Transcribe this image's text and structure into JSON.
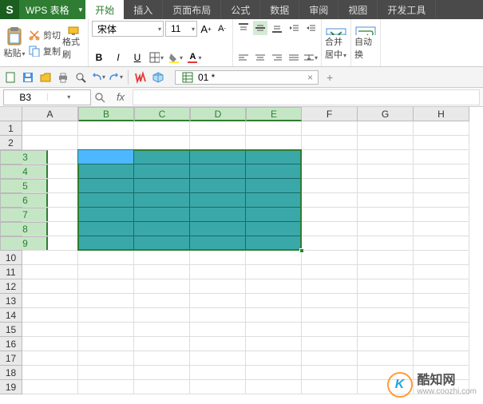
{
  "app": {
    "name": "WPS 表格"
  },
  "tabs": [
    "开始",
    "插入",
    "页面布局",
    "公式",
    "数据",
    "审阅",
    "视图",
    "开发工具"
  ],
  "active_tab": 0,
  "ribbon": {
    "paste": "粘贴",
    "cut": "剪切",
    "copy": "复制",
    "format_painter": "格式刷",
    "font_name": "宋体",
    "font_size": "11",
    "merge_center": "合并居中",
    "auto_wrap": "自动换"
  },
  "qat": {
    "doc_name": "01 *"
  },
  "namebox": "B3",
  "columns": [
    "A",
    "B",
    "C",
    "D",
    "E",
    "F",
    "G",
    "H"
  ],
  "sel_cols": [
    "B",
    "C",
    "D",
    "E"
  ],
  "rows": [
    1,
    2,
    3,
    4,
    5,
    6,
    7,
    8,
    9,
    10,
    11,
    12,
    13,
    14,
    15,
    16,
    17,
    18,
    19
  ],
  "sel_rows": [
    3,
    4,
    5,
    6,
    7,
    8,
    9
  ],
  "fill": {
    "col_start": 1,
    "col_end": 4,
    "row_start": 2,
    "row_end": 8
  },
  "watermark": {
    "cn": "酷知网",
    "en": "www.coozhi.com",
    "logo": "K"
  }
}
